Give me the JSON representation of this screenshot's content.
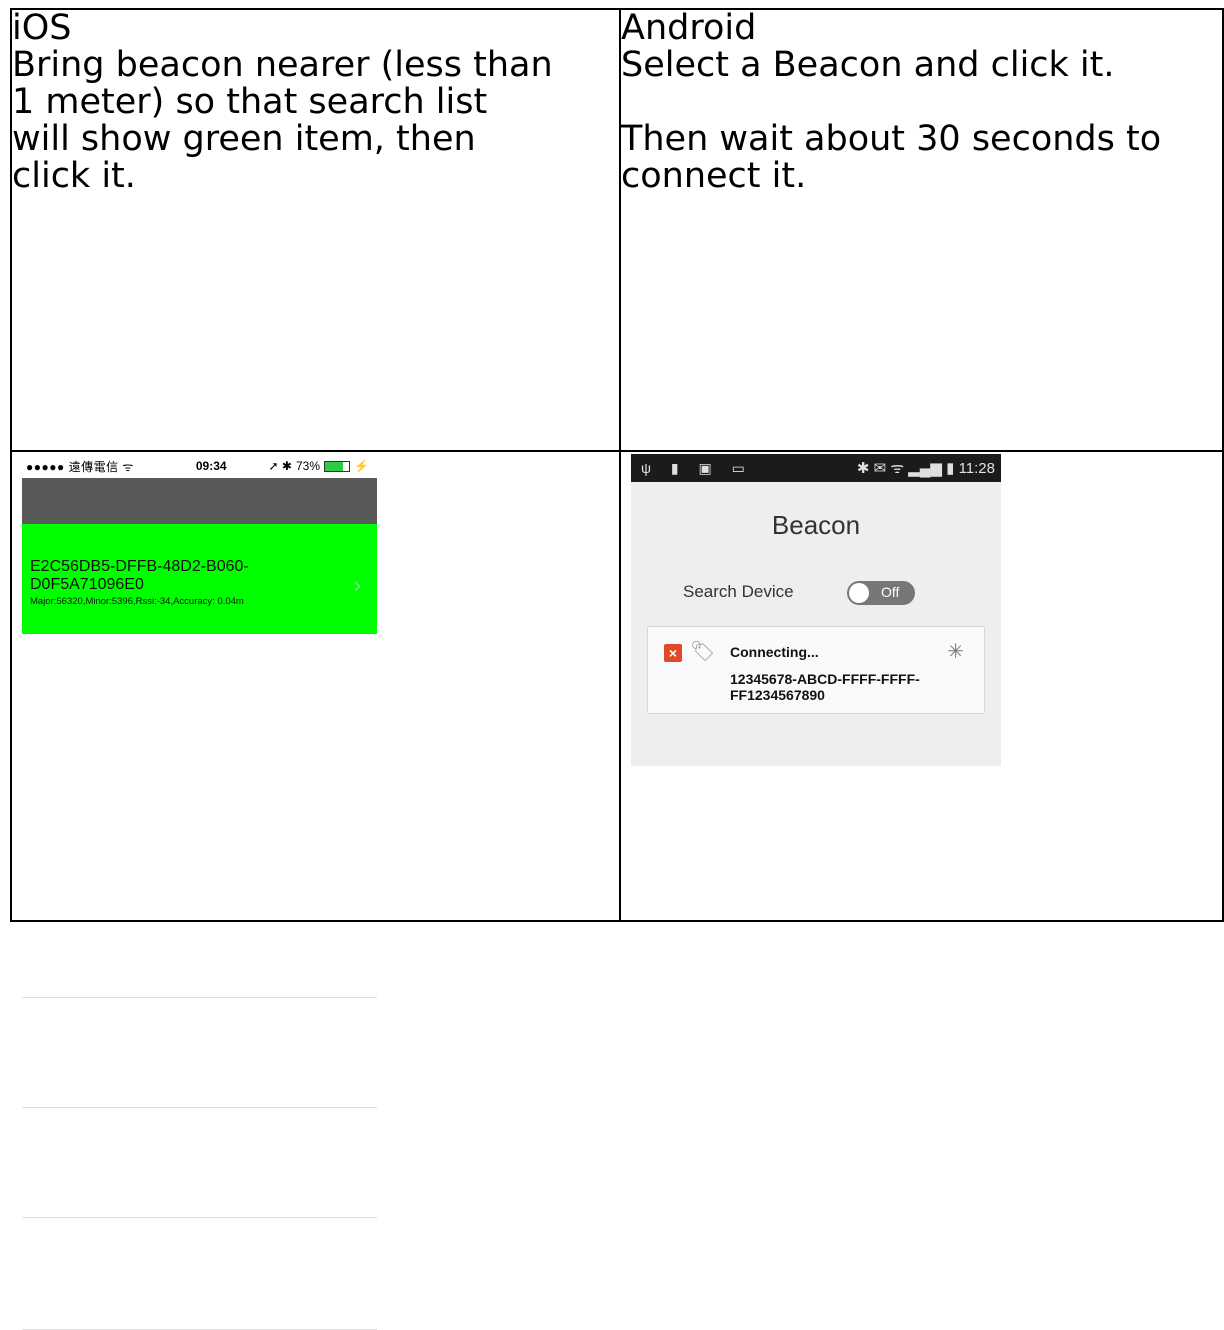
{
  "columns": [
    {
      "heading": "iOS",
      "lines": [
        "Bring beacon nearer (less than",
        "1 meter) so that search list",
        "will show green item, then",
        "click it."
      ]
    },
    {
      "heading": "Android",
      "lines": [
        "Select a Beacon and click it.",
        "",
        "Then wait about 30 seconds to",
        "connect it."
      ]
    }
  ],
  "ios": {
    "status_bar": {
      "carrier": "●●●●● 遠傳電信 ᯤ",
      "time": "09:34",
      "location_bt": "➚ ✱",
      "battery_percent": "73%",
      "battery_level": 0.73,
      "charging": "⚡"
    },
    "item": {
      "uuid_line1": "E2C56DB5-DFFB-48D2-B060-",
      "uuid_line2": "D0F5A71096E0",
      "meta": "Major:56320,Minor:5396,Rssi:-34,Accuracy: 0.04m",
      "highlight_color": "#00ff00"
    }
  },
  "android": {
    "status_bar": {
      "left_icons": "ψ ▮ ▣ ▭",
      "right_icons": "✱ ✉ ᯤ ▂▄▆ ▮",
      "time": "11:28"
    },
    "title": "Beacon",
    "search_label": "Search Device",
    "toggle_label": "Off",
    "card": {
      "status": "Connecting...",
      "uuid": "12345678-ABCD-FFFF-FFFF-FF1234567890"
    }
  }
}
